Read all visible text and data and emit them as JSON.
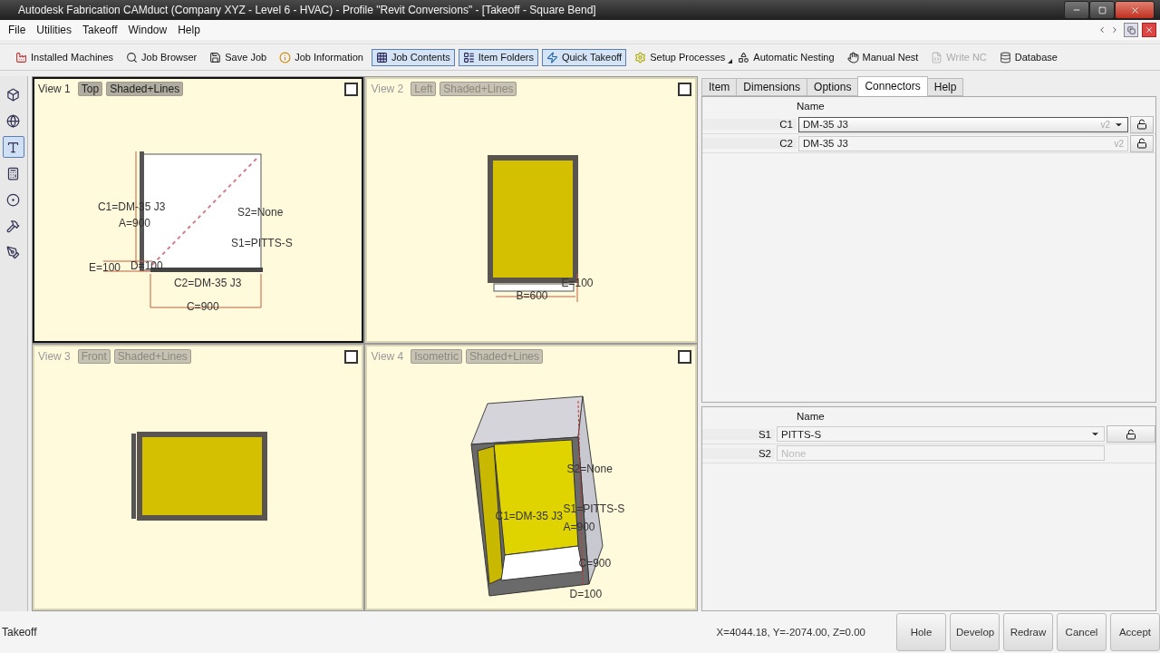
{
  "window": {
    "title": "Autodesk Fabrication CAMduct (Company XYZ - Level 6 - HVAC) - Profile \"Revit Conversions\" - [Takeoff - Square Bend]"
  },
  "menu": [
    "File",
    "Utilities",
    "Takeoff",
    "Window",
    "Help"
  ],
  "toolbar": [
    {
      "label": "Installed Machines",
      "pressed": false,
      "disabled": false
    },
    {
      "label": "Job Browser",
      "pressed": false,
      "disabled": false
    },
    {
      "label": "Save Job",
      "pressed": false,
      "disabled": false
    },
    {
      "label": "Job Information",
      "pressed": false,
      "disabled": false
    },
    {
      "label": "Job Contents",
      "pressed": true,
      "disabled": false
    },
    {
      "label": "Item Folders",
      "pressed": true,
      "disabled": false
    },
    {
      "label": "Quick Takeoff",
      "pressed": true,
      "disabled": false
    },
    {
      "label": "Setup Processes",
      "pressed": false,
      "disabled": false,
      "menu": true
    },
    {
      "label": "Automatic Nesting",
      "pressed": false,
      "disabled": false
    },
    {
      "label": "Manual Nest",
      "pressed": false,
      "disabled": false
    },
    {
      "label": "Write NC",
      "pressed": false,
      "disabled": true
    },
    {
      "label": "Database",
      "pressed": false,
      "disabled": false
    }
  ],
  "tools": [
    {
      "selected": false
    },
    {
      "selected": false
    },
    {
      "selected": true
    },
    {
      "selected": false
    },
    {
      "selected": false
    },
    {
      "selected": false
    },
    {
      "selected": false
    }
  ],
  "views": [
    {
      "title": "View 1",
      "projection": "Top",
      "mode": "Shaded+Lines",
      "active": true,
      "kind": "top",
      "labels": [
        "C1=DM-35 J3",
        "A=900",
        "S2=None",
        "S1=PITTS-S",
        "E=100",
        "D=100",
        "C2=DM-35 J3",
        "C=900"
      ]
    },
    {
      "title": "View 2",
      "projection": "Left",
      "mode": "Shaded+Lines",
      "active": false,
      "kind": "side",
      "labels": [
        "E=100",
        "B=600"
      ]
    },
    {
      "title": "View 3",
      "projection": "Front",
      "mode": "Shaded+Lines",
      "active": false,
      "kind": "front"
    },
    {
      "title": "View 4",
      "projection": "Isometric",
      "mode": "Shaded+Lines",
      "active": false,
      "kind": "isometric",
      "labels": [
        "S2=None",
        "S1=PITTS-S",
        "C1=DM-35 J3",
        "A=900",
        "C=900",
        "D=100"
      ]
    }
  ],
  "tabs": [
    {
      "label": "Item",
      "selected": false
    },
    {
      "label": "Dimensions",
      "selected": false
    },
    {
      "label": "Options",
      "selected": false
    },
    {
      "label": "Connectors",
      "selected": true
    },
    {
      "label": "Help",
      "selected": false
    }
  ],
  "connectors": {
    "column": "Name",
    "rows": [
      {
        "id": "C1",
        "value": "DM-35 J3",
        "version": "v2",
        "dropdown": true,
        "focused": true,
        "lock_button": true
      },
      {
        "id": "C2",
        "value": "DM-35 J3",
        "version": "v2",
        "dropdown": false,
        "focused": false,
        "lock_button": true
      }
    ]
  },
  "seams": {
    "column": "Name",
    "rows": [
      {
        "id": "S1",
        "value": "PITTS-S",
        "dropdown": true,
        "focused": false,
        "lock_button": true
      },
      {
        "id": "S2",
        "placeholder": "None",
        "dropdown": false,
        "focused": false,
        "lock_button": false
      }
    ]
  },
  "status_bar": {
    "mode": "Takeoff",
    "coordinates": "X=4044.18, Y=-2074.00, Z=0.00",
    "buttons": [
      "Hole",
      "Develop",
      "Redraw",
      "Cancel",
      "Accept"
    ]
  }
}
